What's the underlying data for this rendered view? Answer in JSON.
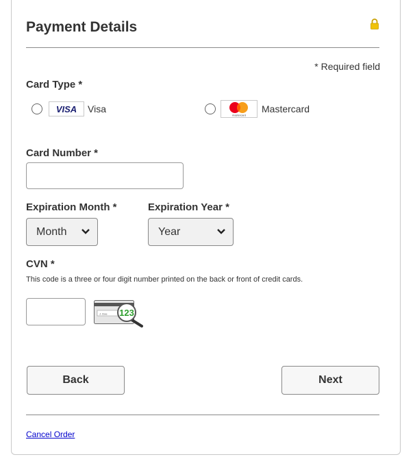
{
  "header": {
    "title": "Payment Details",
    "lock_icon": "lock-icon",
    "accent": "#e8b400"
  },
  "required_note": "* Required field",
  "card_type": {
    "label": "Card Type *",
    "options": [
      {
        "brand_badge": "VISA",
        "name": "Visa",
        "selected": false
      },
      {
        "name": "Mastercard",
        "logo_caption": "mastercard",
        "selected": false
      }
    ]
  },
  "card_number": {
    "label": "Card Number *",
    "value": ""
  },
  "expiration_month": {
    "label": "Expiration Month *",
    "selected": "Month"
  },
  "expiration_year": {
    "label": "Expiration Year *",
    "selected": "Year"
  },
  "cvn": {
    "label": "CVN *",
    "hint": "This code is a three or four digit number printed on the back or front of credit cards.",
    "value": "",
    "example_digits": "123"
  },
  "buttons": {
    "back": "Back",
    "next": "Next"
  },
  "footer": {
    "cancel_link": "Cancel Order"
  }
}
